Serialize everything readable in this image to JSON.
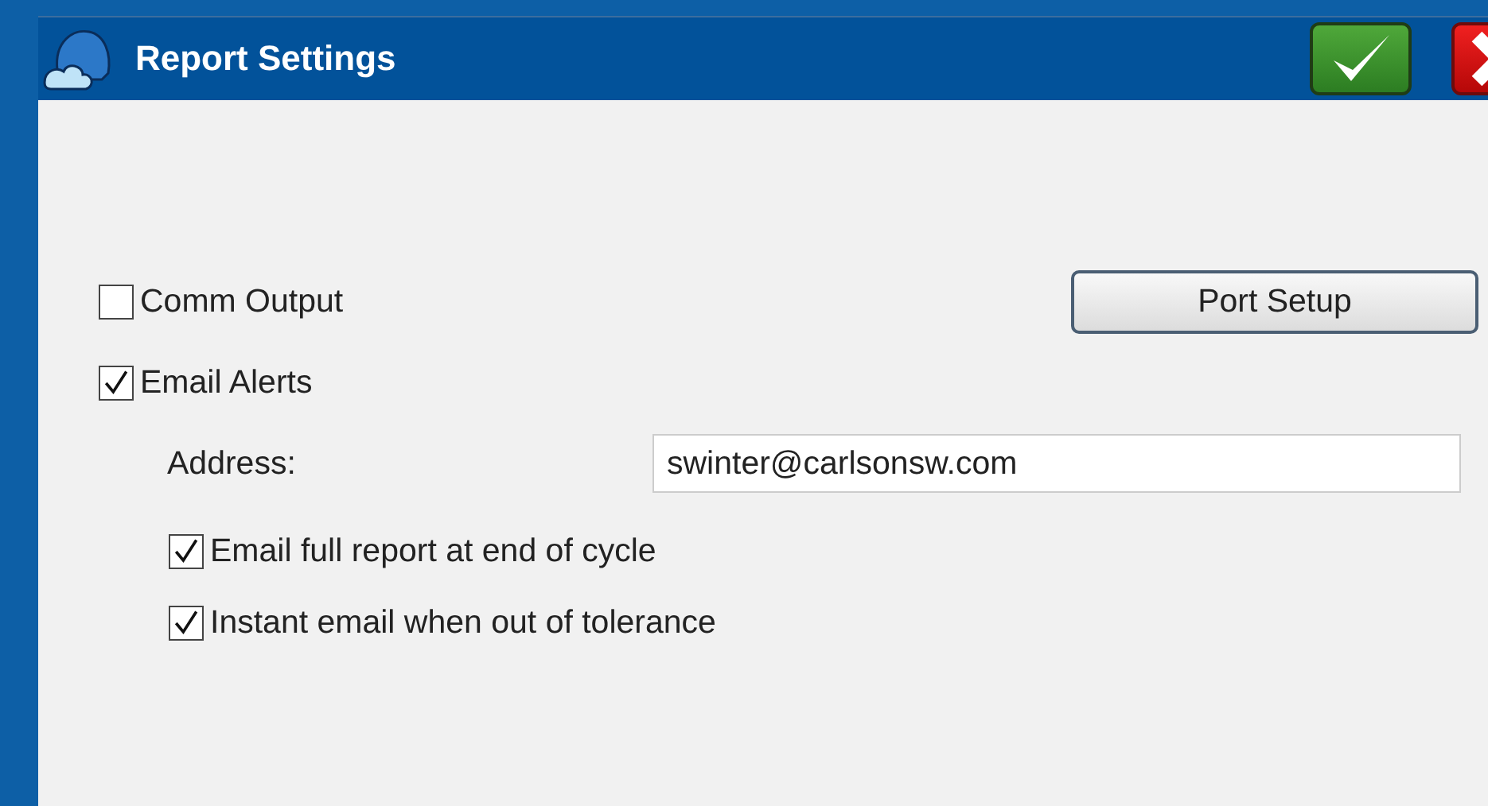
{
  "window": {
    "title": "Report Settings"
  },
  "comm_output": {
    "label": "Comm Output",
    "checked": false
  },
  "port_setup_button": {
    "label": "Port Setup"
  },
  "email_alerts": {
    "label": "Email Alerts",
    "checked": true
  },
  "address": {
    "label": "Address:",
    "value": "swinter@carlsonsw.com"
  },
  "email_options": [
    {
      "label": "Email full report at end of cycle",
      "checked": true
    },
    {
      "label": "Instant email when out of tolerance",
      "checked": true
    }
  ]
}
